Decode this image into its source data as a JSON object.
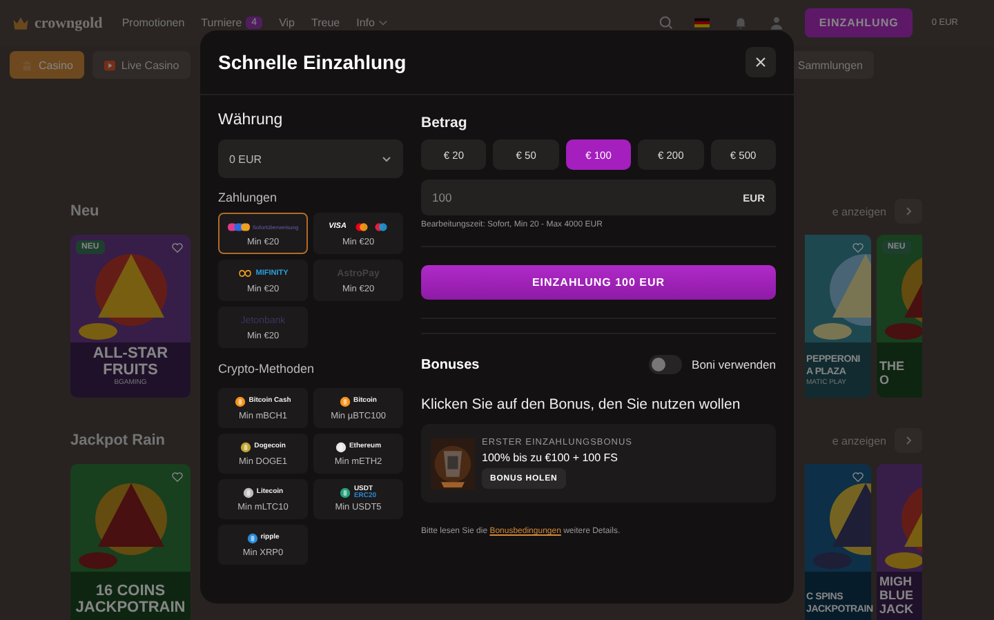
{
  "header": {
    "logo": "crowngold",
    "nav": [
      {
        "label": "Promotionen"
      },
      {
        "label": "Turniere",
        "badge": "4"
      },
      {
        "label": "Vip"
      },
      {
        "label": "Treue"
      },
      {
        "label": "Info",
        "dropdown": true
      }
    ],
    "deposit_button": "EINZAHLUNG",
    "balance": "0 EUR"
  },
  "categories": [
    {
      "label": "Casino",
      "selected": true
    },
    {
      "label": "Live Casino",
      "selected": false
    }
  ],
  "categories_end": [
    {
      "label": "Sammlungen",
      "selected": false
    }
  ],
  "sections": [
    {
      "title": "Neu",
      "link": "e anzeigen",
      "tiles_start": [
        {
          "lines": [
            "ALL-STAR",
            "FRUITS"
          ],
          "provider": "BGAMING",
          "badge": "NEU",
          "heart": true
        }
      ],
      "tiles_end": [
        {
          "lines": [
            "PEPPERONI",
            "A PLAZA"
          ],
          "provider": "MATIC PLAY",
          "heart": true
        },
        {
          "lines": [
            "THE",
            "O"
          ],
          "badge": "NEU",
          "heart": false
        }
      ]
    },
    {
      "title": "Jackpot Rain",
      "link": "e anzeigen",
      "tiles_start": [
        {
          "lines": [
            "16 COINS",
            "JACKPOTRAIN"
          ],
          "heart": true
        }
      ],
      "tiles_end": [
        {
          "lines": [
            "C SPINS",
            "JACKPOTRAIN"
          ],
          "heart": true
        },
        {
          "lines": [
            "MIGH",
            "BLUE",
            "JACK"
          ],
          "heart": false
        }
      ]
    }
  ],
  "modal": {
    "title": "Schnelle Einzahlung",
    "currency": {
      "label": "Währung",
      "value": "0 EUR"
    },
    "payments": {
      "label": "Zahlungen",
      "items": [
        {
          "kind": "sofort",
          "name": "Sofortüberweisung",
          "min": "Min €20",
          "selected": true
        },
        {
          "kind": "cards",
          "name": "VISA",
          "min": "Min €20",
          "selected": false
        },
        {
          "kind": "mifinity",
          "name": "MIFINITY",
          "min": "Min €20",
          "selected": false
        },
        {
          "kind": "astropay",
          "name": "AstroPay",
          "min": "Min €20",
          "selected": false
        },
        {
          "kind": "jeton",
          "name": "Jetonbank",
          "min": "Min €20",
          "selected": false
        }
      ]
    },
    "crypto": {
      "label": "Crypto-Methoden",
      "items": [
        {
          "name": "Bitcoin Cash",
          "min": "Min mBCH1",
          "color": "#f7931a",
          "selected": false
        },
        {
          "name": "Bitcoin",
          "min": "Min µBTC100",
          "color": "#f7931a",
          "selected": false
        },
        {
          "name": "Dogecoin",
          "min": "Min DOGE1",
          "color": "#c2a633",
          "selected": false
        },
        {
          "name": "Ethereum",
          "min": "Min mETH2",
          "color": "#e6e6e6",
          "selected": false
        },
        {
          "name": "Litecoin",
          "min": "Min mLTC10",
          "color": "#bebebe",
          "selected": false
        },
        {
          "name": "USDT",
          "sub": "ERC20",
          "min": "Min USDT5",
          "color": "#26a17b",
          "selected": false
        },
        {
          "name": "ripple",
          "min": "Min XRP0",
          "color": "#2a8ad8",
          "selected": false
        }
      ]
    },
    "amount": {
      "label": "Betrag",
      "presets": [
        {
          "label": "€ 20",
          "selected": false
        },
        {
          "label": "€ 50",
          "selected": false
        },
        {
          "label": "€ 100",
          "selected": true
        },
        {
          "label": "€ 200",
          "selected": false
        },
        {
          "label": "€ 500",
          "selected": false
        }
      ],
      "value": "100",
      "currency": "EUR",
      "hint": "Bearbeitungszeit: Sofort, Min 20 - Max 4000 EUR"
    },
    "submit": "EINZAHLUNG 100 EUR",
    "bonuses": {
      "title": "Bonuses",
      "toggle": {
        "label": "Boni verwenden",
        "on": false
      },
      "prompt": "Klicken Sie auf den Bonus, den Sie nutzen wollen",
      "items": [
        {
          "title": "ERSTER EINZAHLUNGSBONUS",
          "offer": "100% bis zu €100 + 100 FS",
          "button": "BONUS HOLEN"
        }
      ],
      "note_before": "Bitte lesen Sie die",
      "note_link": "Bonusbedingungen",
      "note_after": "weitere Details."
    }
  }
}
